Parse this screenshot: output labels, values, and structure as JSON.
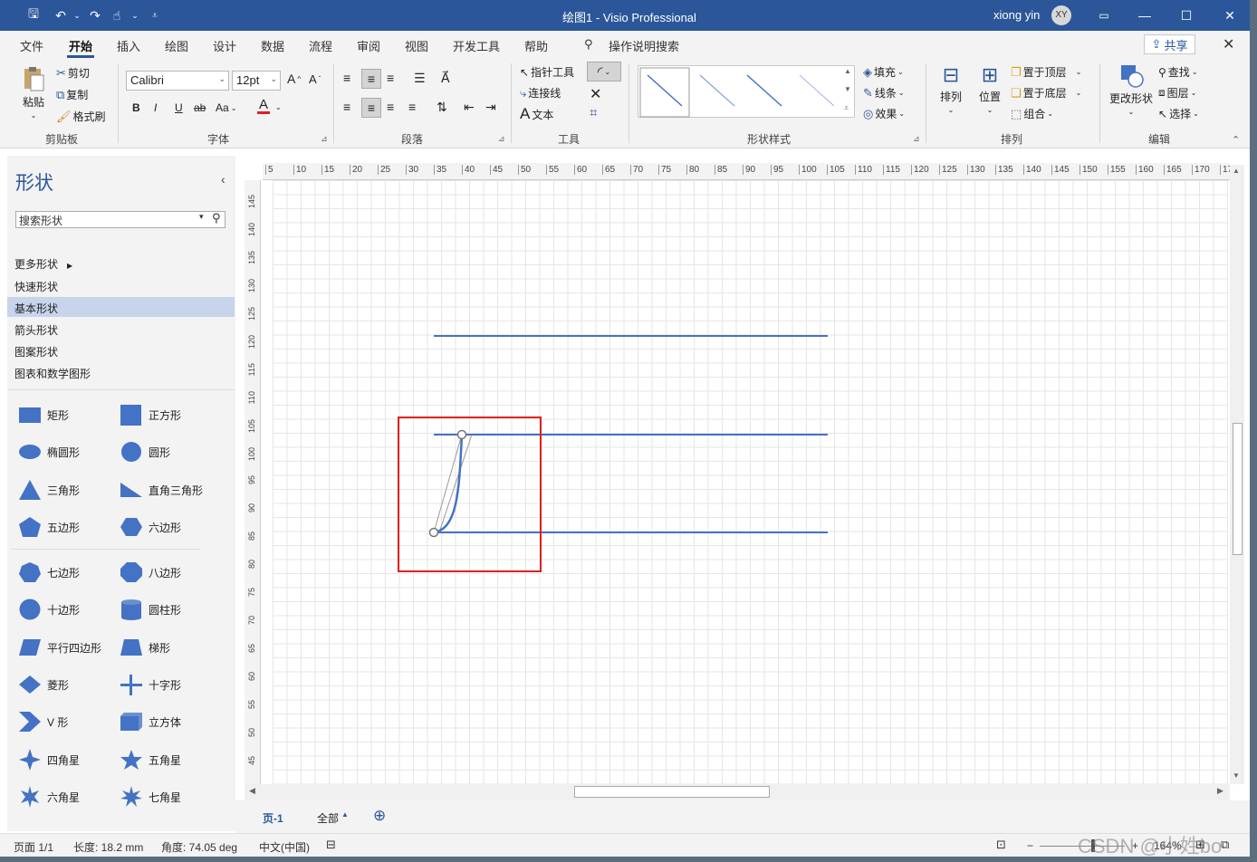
{
  "title_bar": {
    "document_title": "绘图1  -  Visio Professional",
    "user_name": "xiong yin",
    "avatar_initials": "XY"
  },
  "ribbon_tabs": [
    "文件",
    "开始",
    "插入",
    "绘图",
    "设计",
    "数据",
    "流程",
    "审阅",
    "视图",
    "开发工具",
    "帮助"
  ],
  "active_tab": "开始",
  "tell_me": "操作说明搜索",
  "share_label": "共享",
  "clipboard": {
    "paste": "粘贴",
    "cut": "剪切",
    "copy": "复制",
    "format_painter": "格式刷",
    "group": "剪贴板"
  },
  "font": {
    "family": "Calibri",
    "size": "12pt",
    "bold": "B",
    "italic": "I",
    "underline": "U",
    "strike": "ab",
    "case": "Aa",
    "group": "字体"
  },
  "paragraph": {
    "group": "段落"
  },
  "tools": {
    "pointer": "指针工具",
    "connector": "连接线",
    "text": "文本",
    "group": "工具"
  },
  "shape_styles": {
    "group": "形状样式",
    "fill": "填充",
    "line": "线条",
    "effects": "效果"
  },
  "arrange": {
    "arrange": "排列",
    "position": "位置",
    "bring_front": "置于顶层",
    "send_back": "置于底层",
    "group_btn": "组合",
    "group": "排列"
  },
  "editing": {
    "change_shape": "更改形状",
    "find": "查找",
    "layers": "图层",
    "select": "选择",
    "group": "编辑"
  },
  "shapes_panel": {
    "title": "形状",
    "search_placeholder": "搜索形状",
    "stencils": [
      "更多形状",
      "快速形状",
      "基本形状",
      "箭头形状",
      "图案形状",
      "图表和数学图形"
    ],
    "selected_stencil": "基本形状",
    "shapes": [
      "矩形",
      "正方形",
      "椭圆形",
      "圆形",
      "三角形",
      "直角三角形",
      "五边形",
      "六边形",
      "七边形",
      "八边形",
      "十边形",
      "圆柱形",
      "平行四边形",
      "梯形",
      "菱形",
      "十字形",
      "V 形",
      "立方体",
      "四角星",
      "五角星",
      "六角星",
      "七角星"
    ]
  },
  "ruler_top": [
    "5",
    "10",
    "15",
    "20",
    "25",
    "30",
    "35",
    "40",
    "45",
    "50",
    "55",
    "60",
    "65",
    "70",
    "75",
    "80",
    "85",
    "90",
    "95",
    "100",
    "105",
    "110",
    "115",
    "120",
    "125",
    "130",
    "135",
    "140",
    "145",
    "150",
    "155",
    "160",
    "165",
    "170",
    "17"
  ],
  "ruler_left": [
    "145",
    "140",
    "135",
    "130",
    "125",
    "120",
    "115",
    "110",
    "105",
    "100",
    "95",
    "90",
    "85",
    "80",
    "75",
    "70",
    "65",
    "60",
    "55",
    "50",
    "45"
  ],
  "page_tabs": {
    "page": "页-1",
    "all": "全部"
  },
  "status": {
    "page": "页面 1/1",
    "length": "长度: 18.2 mm",
    "angle": "角度: 74.05 deg",
    "language": "中文(中国)",
    "zoom": "164%",
    "watermark": "CSDN @小姓bo"
  },
  "colors": {
    "accent": "#2b579a",
    "shape_fill": "#4472c4",
    "line": "#4472c4",
    "highlight": "#e02020"
  }
}
